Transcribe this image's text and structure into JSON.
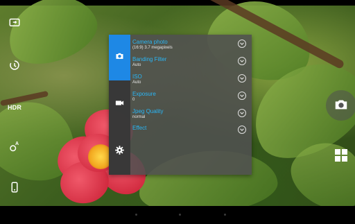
{
  "settings_panel": {
    "tabs": [
      {
        "name": "photo",
        "icon": "camera-icon",
        "active": true
      },
      {
        "name": "video",
        "icon": "video-camera-icon",
        "active": false
      },
      {
        "name": "preferences",
        "icon": "gear-icon",
        "active": false
      }
    ],
    "rows": [
      {
        "title": "Camera photo",
        "value": "(16:9) 3.7 megapixels"
      },
      {
        "title": "Banding Filter",
        "value": "Auto"
      },
      {
        "title": "ISO",
        "value": "Auto"
      },
      {
        "title": "Exposure",
        "value": "0"
      },
      {
        "title": "Jpeg Quality",
        "value": "normal"
      },
      {
        "title": "Effect",
        "value": ""
      }
    ]
  },
  "left_controls": {
    "hdr_label": "HDR",
    "white_balance_label": "A"
  },
  "colors": {
    "accent": "#1e88e5",
    "setting_title": "#29b6f6",
    "panel_bg": "#505050"
  }
}
